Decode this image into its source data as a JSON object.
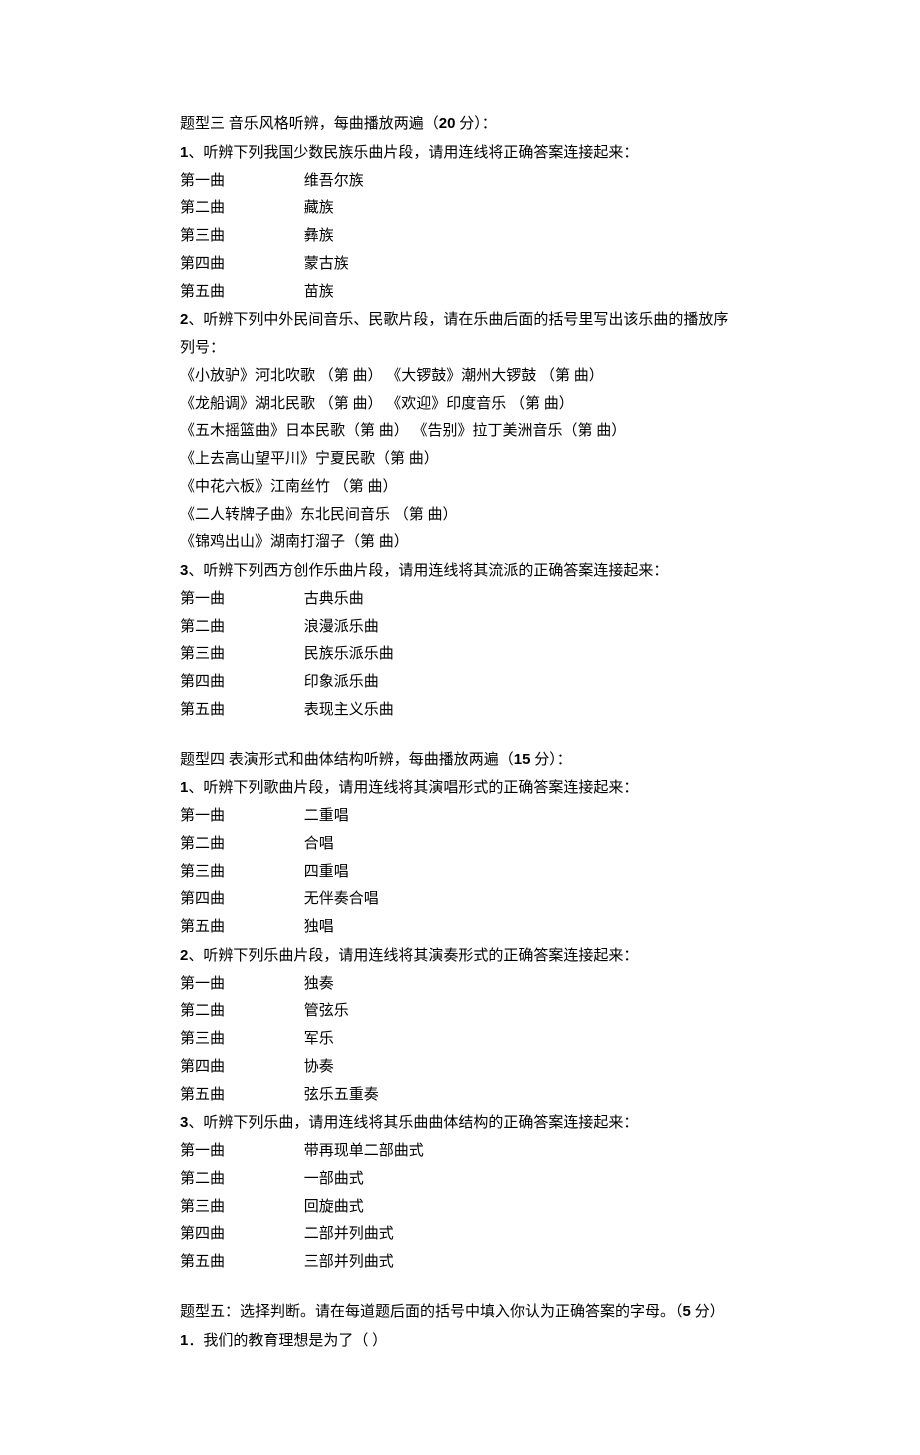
{
  "section3": {
    "heading_prefix": "题型三 音乐风格听辨，每曲播放两遍（",
    "points": "20",
    "heading_suffix": " 分）：",
    "q1": {
      "num": "1",
      "prompt": "、听辨下列我国少数民族乐曲片段，请用连线将正确答案连接起来：",
      "rows": [
        {
          "left": "第一曲",
          "right": "维吾尔族"
        },
        {
          "left": "第二曲",
          "right": "藏族"
        },
        {
          "left": "第三曲",
          "right": "彝族"
        },
        {
          "left": "第四曲",
          "right": "蒙古族"
        },
        {
          "left": "第五曲",
          "right": "苗族"
        }
      ]
    },
    "q2": {
      "num": "2",
      "prompt": "、听辨下列中外民间音乐、民歌片段，请在乐曲后面的括号里写出该乐曲的播放序列号：",
      "lines": [
        "《小放驴》河北吹歌 （第 曲） 《大锣鼓》潮州大锣鼓 （第   曲）",
        "《龙船调》湖北民歌 （第 曲） 《欢迎》印度音乐 （第   曲）",
        "《五木摇篮曲》日本民歌（第 曲） 《告别》拉丁美洲音乐（第   曲）",
        "《上去高山望平川》宁夏民歌（第 曲）",
        "《中花六板》江南丝竹 （第 曲）",
        "《二人转牌子曲》东北民间音乐 （第   曲）",
        "《锦鸡出山》湖南打溜子（第   曲）"
      ]
    },
    "q3": {
      "num": "3",
      "prompt": "、听辨下列西方创作乐曲片段，请用连线将其流派的正确答案连接起来：",
      "rows": [
        {
          "left": "第一曲",
          "right": "古典乐曲"
        },
        {
          "left": "第二曲",
          "right": "浪漫派乐曲"
        },
        {
          "left": "第三曲",
          "right": "民族乐派乐曲"
        },
        {
          "left": "第四曲",
          "right": "印象派乐曲"
        },
        {
          "left": "第五曲",
          "right": "表现主义乐曲"
        }
      ]
    }
  },
  "section4": {
    "heading_prefix": "题型四 表演形式和曲体结构听辨，每曲播放两遍（",
    "points": "15",
    "heading_suffix": " 分）：",
    "q1": {
      "num": "1",
      "prompt": "、听辨下列歌曲片段，请用连线将其演唱形式的正确答案连接起来：",
      "rows": [
        {
          "left": "第一曲",
          "right": "二重唱"
        },
        {
          "left": "第二曲",
          "right": "合唱"
        },
        {
          "left": "第三曲",
          "right": "四重唱"
        },
        {
          "left": "第四曲",
          "right": "无伴奏合唱"
        },
        {
          "left": "第五曲",
          "right": "独唱"
        }
      ]
    },
    "q2": {
      "num": "2",
      "prompt": "、听辨下列乐曲片段，请用连线将其演奏形式的正确答案连接起来：",
      "rows": [
        {
          "left": "第一曲",
          "right": "独奏"
        },
        {
          "left": "第二曲",
          "right": "管弦乐"
        },
        {
          "left": "第三曲",
          "right": "军乐"
        },
        {
          "left": "第四曲",
          "right": "协奏"
        },
        {
          "left": "第五曲",
          "right": "弦乐五重奏"
        }
      ]
    },
    "q3": {
      "num": "3",
      "prompt": "、听辨下列乐曲，请用连线将其乐曲曲体结构的正确答案连接起来：",
      "rows": [
        {
          "left": "第一曲",
          "right": "带再现单二部曲式"
        },
        {
          "left": "第二曲",
          "right": "一部曲式"
        },
        {
          "left": "第三曲",
          "right": "回旋曲式"
        },
        {
          "left": "第四曲",
          "right": "二部并列曲式"
        },
        {
          "left": "第五曲",
          "right": "三部并列曲式"
        }
      ]
    }
  },
  "section5": {
    "heading_prefix": "题型五：选择判断。请在每道题后面的括号中填入你认为正确答案的字母。（",
    "points": "5",
    "heading_suffix": " 分）",
    "q1": {
      "num": "1",
      "prompt": "．我们的教育理想是为了（    ）"
    }
  }
}
